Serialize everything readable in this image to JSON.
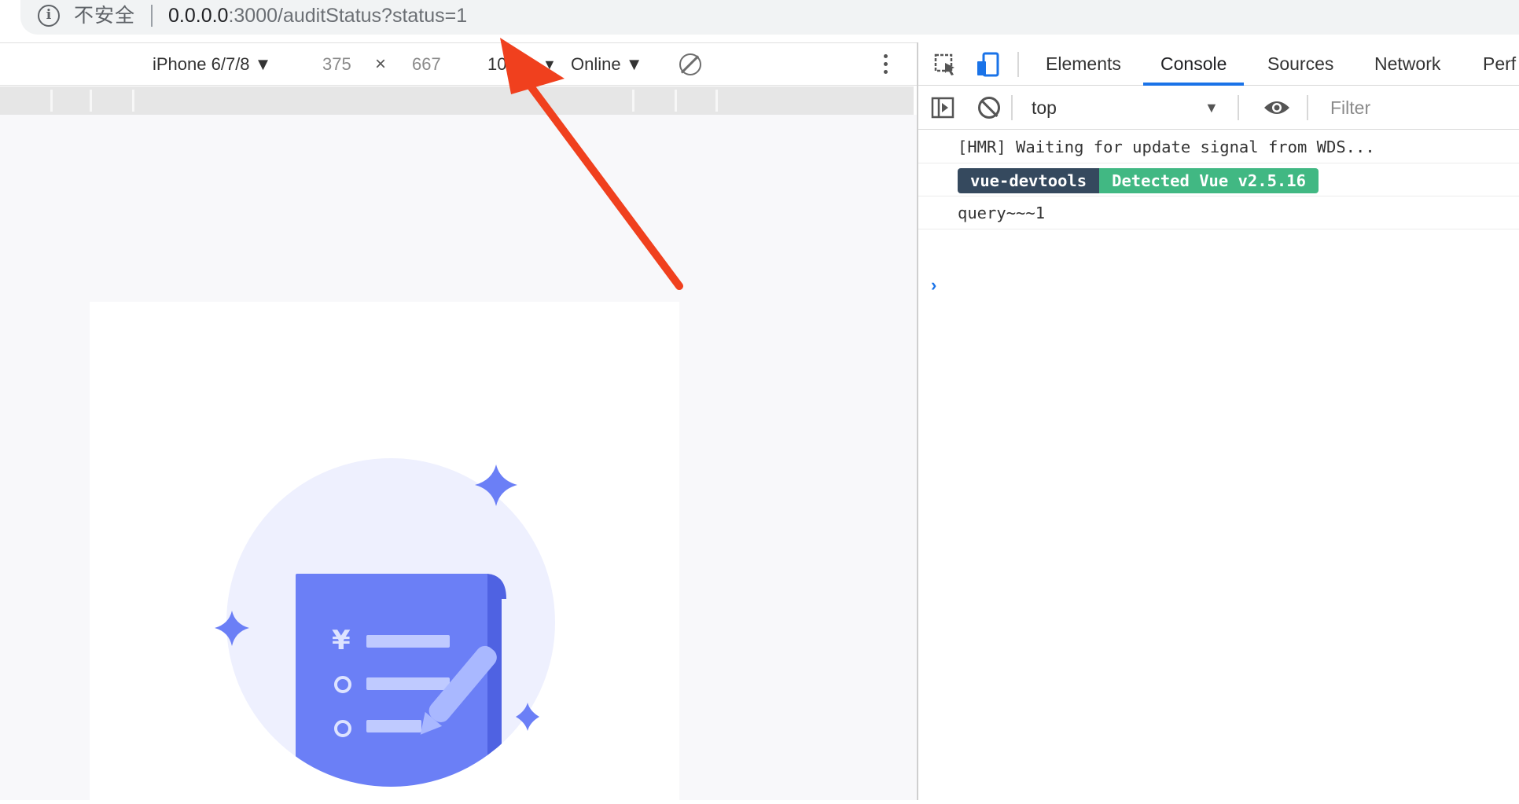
{
  "address_bar": {
    "security_label": "不安全",
    "url_host": "0.0.0.0",
    "url_rest": ":3000/auditStatus?status=1"
  },
  "device_toolbar": {
    "device": "iPhone 6/7/8 ▼",
    "width": "375",
    "times": "×",
    "height": "667",
    "zoom": "10",
    "zoom_arrow": "▼",
    "network": "Online ▼"
  },
  "devtools": {
    "tabs": [
      "Elements",
      "Console",
      "Sources",
      "Network",
      "Perf"
    ],
    "active_tab": "Console",
    "context": "top",
    "context_arrow": "▼",
    "filter_placeholder": "Filter",
    "messages": {
      "hmr": "[HMR] Waiting for update signal from WDS...",
      "badge_left": "vue-devtools",
      "badge_right": "Detected Vue v2.5.16",
      "query": "query~~~1"
    },
    "prompt": "›"
  },
  "illustration": {
    "currency_symbol": "¥"
  },
  "colors": {
    "illustration_primary": "#6b7ff6",
    "illustration_light": "#eef0fe",
    "arrow": "#f0401e",
    "active_tab_underline": "#1a73e8",
    "badge_dark": "#35495e",
    "badge_green": "#41b883"
  }
}
